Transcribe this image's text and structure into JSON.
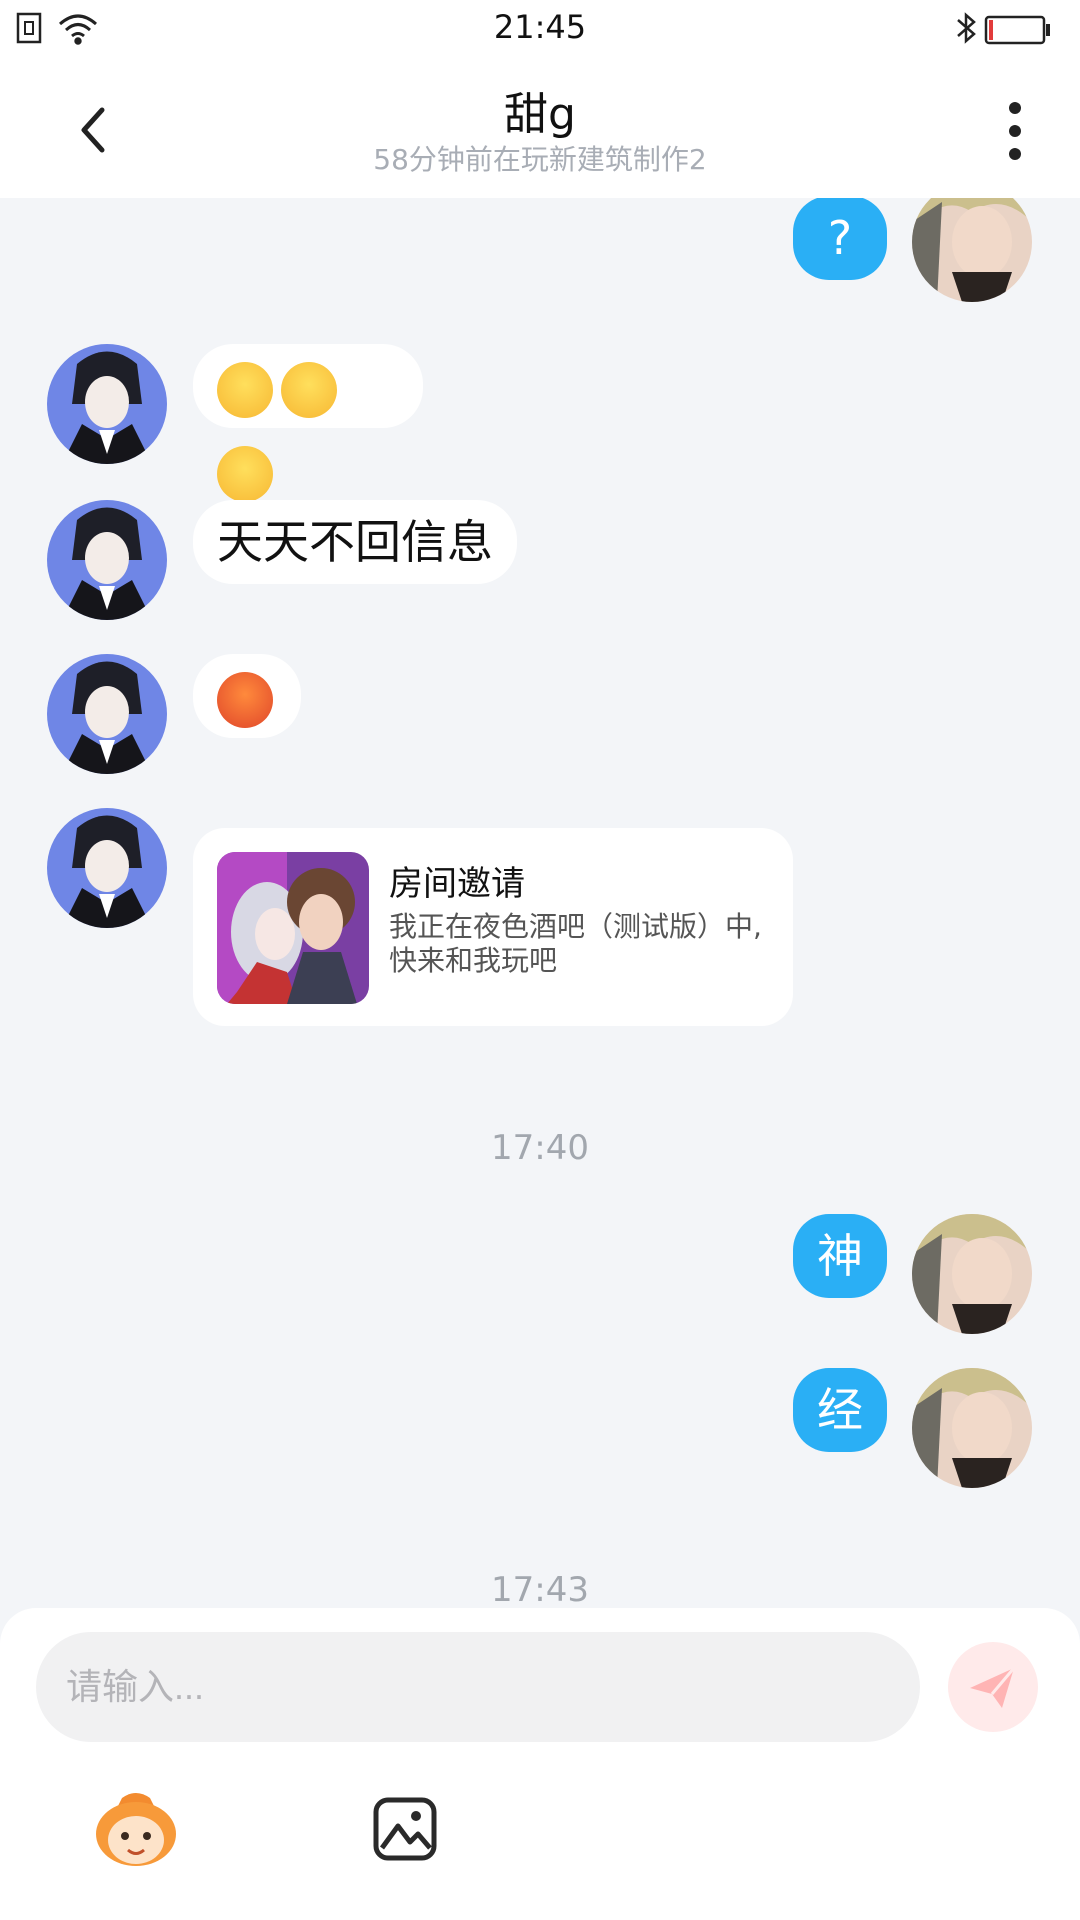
{
  "status_bar": {
    "time": "21:45"
  },
  "header": {
    "title": "甜g",
    "subtitle": "58分钟前在玩新建筑制作2"
  },
  "messages": {
    "me_question": "?",
    "them_emoji_row": "😤😤😤",
    "them_text": "天天不回信息",
    "them_angry": "😡",
    "invite": {
      "title": "房间邀请",
      "desc": "我正在夜色酒吧（测试版）中, 快来和我玩吧"
    },
    "time_1": "17:40",
    "me_shen": "神",
    "me_jing": "经",
    "time_2": "17:43"
  },
  "composer": {
    "placeholder": "请输入..."
  },
  "icons": {
    "back": "back-icon",
    "menu": "more-vertical-icon",
    "send": "send-icon",
    "mascot": "mascot-emoji-icon",
    "image": "image-icon"
  },
  "colors": {
    "accent": "#2aaff5",
    "background": "#f3f5f8",
    "send_disabled": "#ffeaea"
  }
}
